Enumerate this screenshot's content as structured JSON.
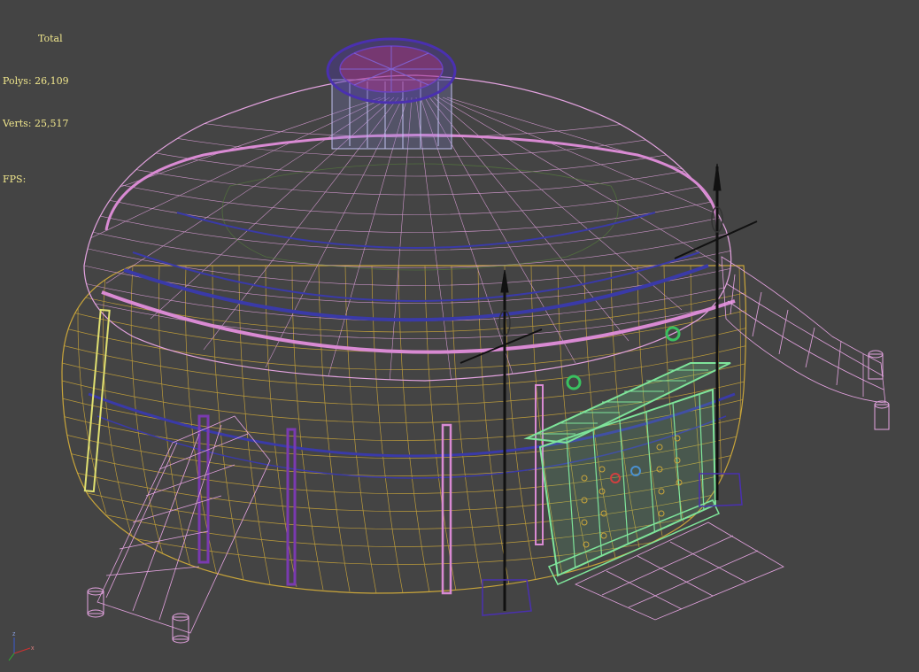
{
  "viewport": {
    "background": "#444444",
    "stats": {
      "header": "Total",
      "polys": "Polys: 26,109",
      "verts": "Verts: 25,517",
      "fps": "FPS:"
    },
    "axis": {
      "z": "z",
      "x": "x"
    }
  },
  "colors": {
    "stats_text": "#f0e68c",
    "body_wire": "#c9a53a",
    "roof_wire": "#e4a3e0",
    "ring_blue": "#3a3aa8",
    "band_pink": "#d98ad3",
    "door_green": "#7ee49a",
    "pole_black": "#111111",
    "crown_purple": "#4a30b0"
  }
}
